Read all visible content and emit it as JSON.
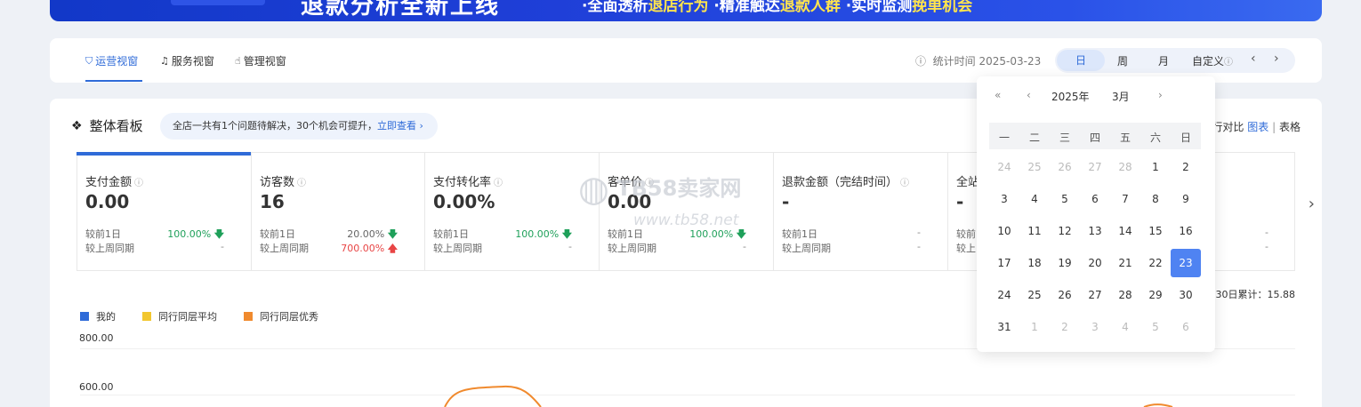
{
  "banner": {
    "headline": "退款分析全新上线",
    "sub_parts": [
      "·全面透析",
      "退店行为",
      " ·精准触达",
      "退款人群",
      " ·实时监测",
      "挽单机会"
    ]
  },
  "tabs": [
    {
      "label": "运营视窗",
      "icon": "shield-icon"
    },
    {
      "label": "服务视窗",
      "icon": "headset-icon"
    },
    {
      "label": "管理视窗",
      "icon": "hand-icon"
    }
  ],
  "stat_time": "统计时间 2025-03-23",
  "period": {
    "day": "日",
    "week": "周",
    "month": "月",
    "custom": "自定义"
  },
  "panel": {
    "title": "整体看板",
    "notice_text": "全店一共有1个问题待解决，30个机会可提升，",
    "notice_link": "立即查看",
    "tools_compare": "行对比",
    "tools_chart": "图表",
    "tools_sep": "|",
    "tools_table": "表格"
  },
  "cards": [
    {
      "name": "支付金额",
      "value": "0.00",
      "r1_label": "较前1日",
      "r1_value": "100.00%",
      "r1_dir": "down",
      "r2_label": "较上周同期",
      "r2_value": "-"
    },
    {
      "name": "访客数",
      "value": "16",
      "r1_label": "较前1日",
      "r1_value": "20.00%",
      "r1_dir": "down",
      "r2_label": "较上周同期",
      "r2_value": "700.00%",
      "r2_dir": "up"
    },
    {
      "name": "支付转化率",
      "value": "0.00%",
      "r1_label": "较前1日",
      "r1_value": "100.00%",
      "r1_dir": "down",
      "r2_label": "较上周同期",
      "r2_value": "-"
    },
    {
      "name": "客单价",
      "value": "0.00",
      "r1_label": "较前1日",
      "r1_value": "100.00%",
      "r1_dir": "down",
      "r2_label": "较上周同期",
      "r2_value": "-"
    },
    {
      "name": "退款金额（完结时间）",
      "value": "-",
      "r1_label": "较前1日",
      "r1_value": "-",
      "r2_label": "较上周同期",
      "r2_value": "-"
    },
    {
      "name": "全站",
      "value": "-",
      "r1_label": "较前",
      "r1_value": "",
      "r2_label": "较上",
      "r2_value": ""
    }
  ],
  "legend": [
    {
      "label": "我的",
      "color": "#2f6bd8"
    },
    {
      "label": "同行同层平均",
      "color": "#f2c72f"
    },
    {
      "label": "同行同层优秀",
      "color": "#f08a2e"
    }
  ],
  "cumulative": "30日累计：15.88",
  "y_ticks": [
    "800.00",
    "600.00"
  ],
  "calendar": {
    "year": "2025年",
    "month": "3月",
    "weekdays": [
      "一",
      "二",
      "三",
      "四",
      "五",
      "六",
      "日"
    ],
    "days": [
      [
        "24",
        "25",
        "26",
        "27",
        "28",
        "1",
        "2"
      ],
      [
        "3",
        "4",
        "5",
        "6",
        "7",
        "8",
        "9"
      ],
      [
        "10",
        "11",
        "12",
        "13",
        "14",
        "15",
        "16"
      ],
      [
        "17",
        "18",
        "19",
        "20",
        "21",
        "22",
        "23"
      ],
      [
        "24",
        "25",
        "26",
        "27",
        "28",
        "29",
        "30"
      ],
      [
        "31",
        "1",
        "2",
        "3",
        "4",
        "5",
        "6"
      ]
    ],
    "selected": "23"
  },
  "watermark": {
    "brand": "TB58卖家网",
    "url": "www.tb58.net"
  }
}
